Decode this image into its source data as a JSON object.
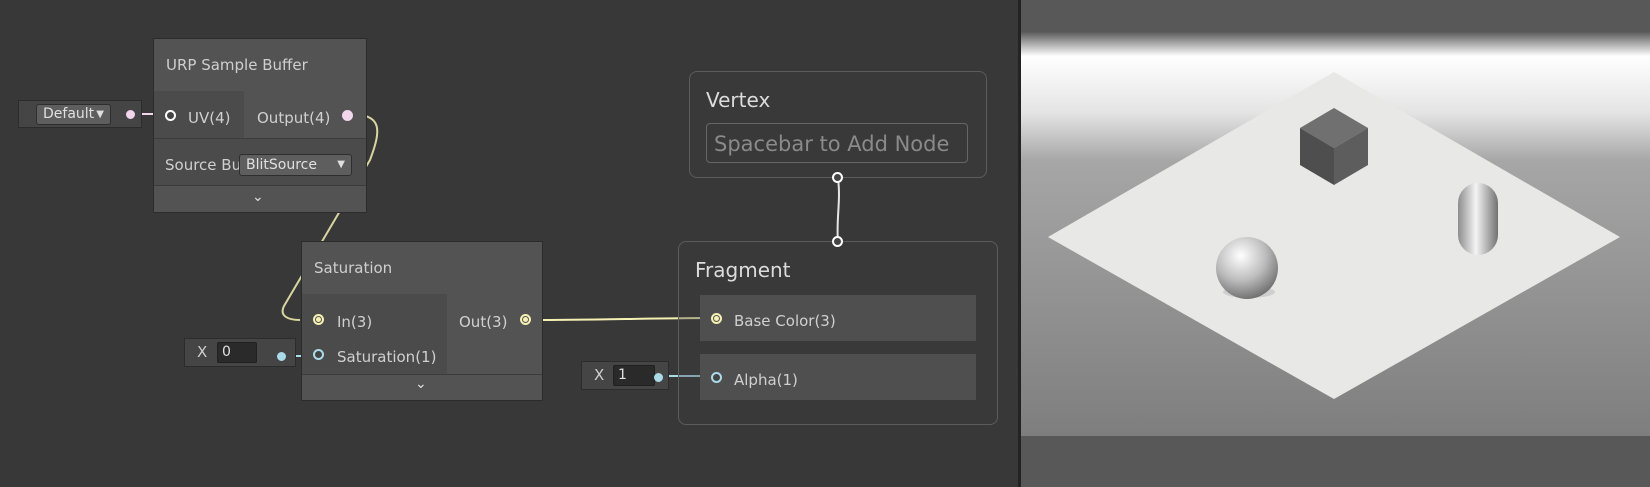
{
  "graph": {
    "urp_node": {
      "title": "URP Sample Buffer",
      "input_uv": "UV(4)",
      "output": "Output(4)",
      "source_label": "Source Bu",
      "source_value": "BlitSource",
      "uv_dropdown": "Default"
    },
    "saturation_node": {
      "title": "Saturation",
      "input_in": "In(3)",
      "input_saturation": "Saturation(1)",
      "output": "Out(3)",
      "x_label": "X",
      "x_value": "0"
    },
    "vertex": {
      "title": "Vertex",
      "placeholder": "Spacebar to Add Node"
    },
    "fragment": {
      "title": "Fragment",
      "base_color": "Base Color(3)",
      "alpha": "Alpha(1)",
      "x_label": "X",
      "x_value": "1"
    }
  },
  "colors": {
    "port_pink": "#f1d6ec",
    "port_yellow": "#f4f1b3",
    "port_cyan": "#a9dce8"
  }
}
